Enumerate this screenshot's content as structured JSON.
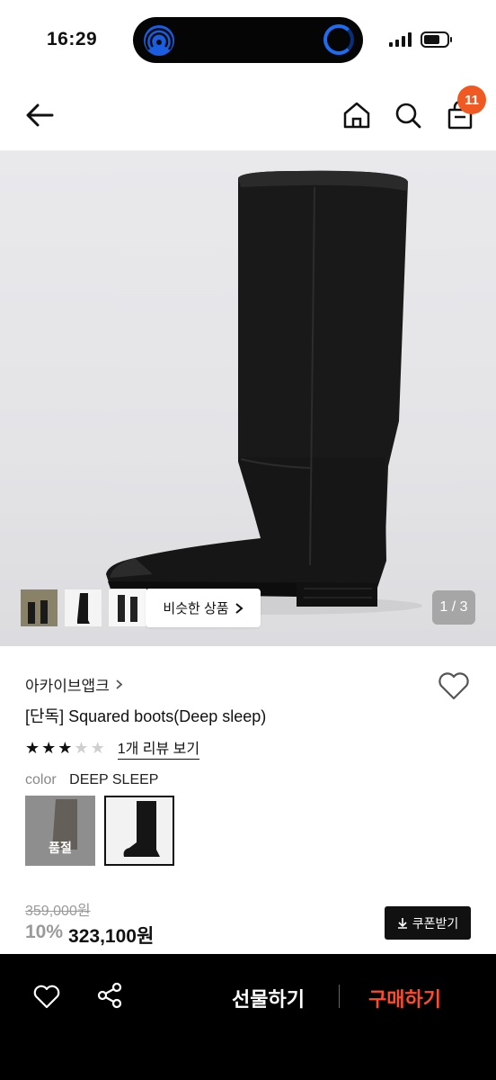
{
  "status": {
    "time": "16:29"
  },
  "header": {
    "cart_count": "11"
  },
  "gallery": {
    "page_indicator": "1 / 3",
    "similar_label": "비슷한 상품"
  },
  "product": {
    "brand": "아카이브앱크",
    "title": "[단독] Squared boots(Deep sleep)",
    "rating_stars": 3,
    "rating_max": 5,
    "review_link": "1개 리뷰 보기",
    "color_label": "color",
    "color_value": "DEEP SLEEP",
    "swatch_soldout_label": "품절",
    "original_price": "359,000원",
    "discount": "10%",
    "price": "323,100원",
    "coupon_label": "쿠폰받기"
  },
  "bottom_bar": {
    "gift_label": "선물하기",
    "buy_label": "구매하기"
  },
  "colors": {
    "accent": "#ff4a2b",
    "badge": "#f05a22"
  }
}
